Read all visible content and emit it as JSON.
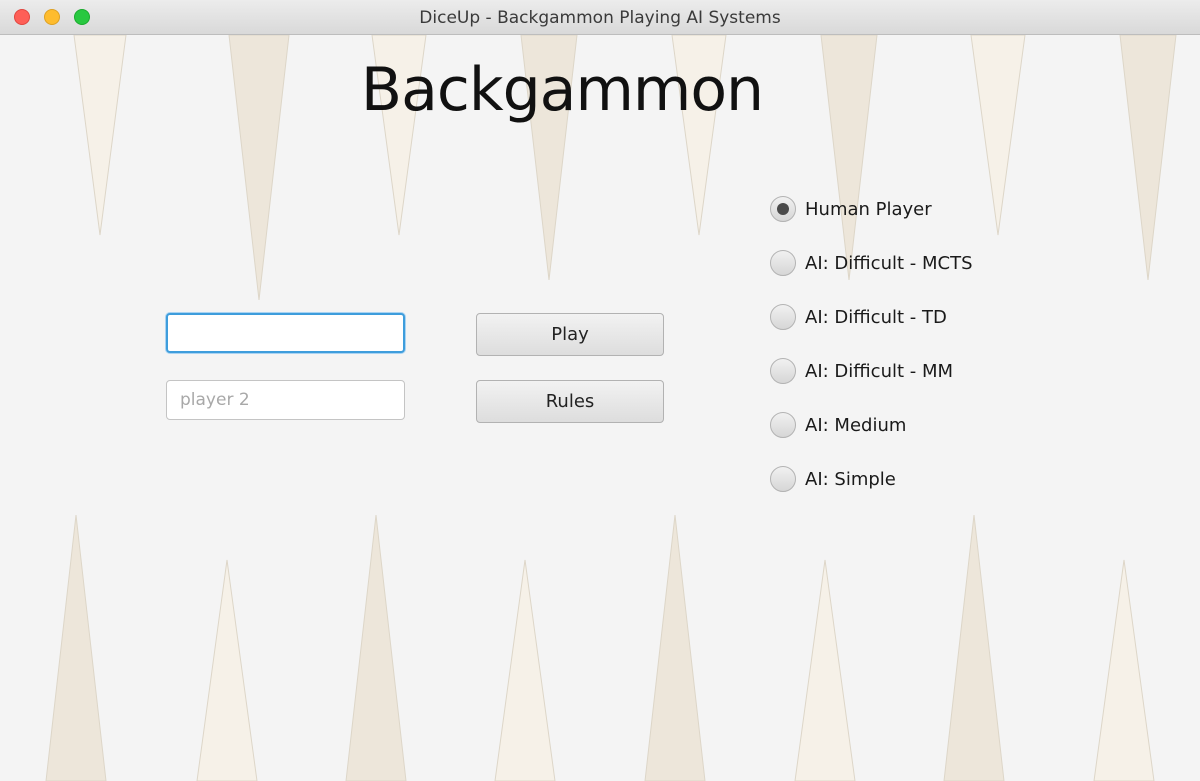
{
  "window": {
    "title": "DiceUp - Backgammon Playing AI Systems"
  },
  "heading": "Backgammon",
  "players": {
    "player1_value": "",
    "player1_placeholder": "",
    "player2_value": "",
    "player2_placeholder": "player 2"
  },
  "buttons": {
    "play_label": "Play",
    "rules_label": "Rules"
  },
  "opponent_options": [
    {
      "label": "Human Player",
      "selected": true
    },
    {
      "label": "AI: Difficult - MCTS",
      "selected": false
    },
    {
      "label": "AI: Difficult - TD",
      "selected": false
    },
    {
      "label": "AI: Difficult - MM",
      "selected": false
    },
    {
      "label": "AI: Medium",
      "selected": false
    },
    {
      "label": "AI: Simple",
      "selected": false
    }
  ],
  "colors": {
    "background": "#f4f4f4",
    "point_dark": "#ede6da",
    "point_light": "#f6f1e8",
    "focus_ring": "#3e9ddc"
  }
}
